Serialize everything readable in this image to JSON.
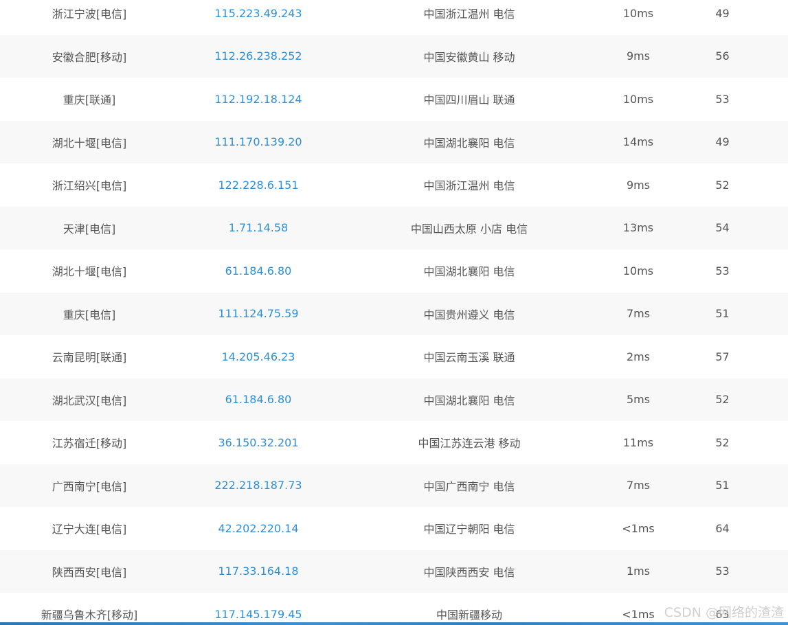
{
  "rows": [
    {
      "node": "浙江宁波[电信]",
      "ip": "115.223.49.243",
      "location": "中国浙江温州 电信",
      "rt": "10ms",
      "ttl": "49"
    },
    {
      "node": "安徽合肥[移动]",
      "ip": "112.26.238.252",
      "location": "中国安徽黄山 移动",
      "rt": "9ms",
      "ttl": "56"
    },
    {
      "node": "重庆[联通]",
      "ip": "112.192.18.124",
      "location": "中国四川眉山 联通",
      "rt": "10ms",
      "ttl": "53"
    },
    {
      "node": "湖北十堰[电信]",
      "ip": "111.170.139.20",
      "location": "中国湖北襄阳 电信",
      "rt": "14ms",
      "ttl": "49"
    },
    {
      "node": "浙江绍兴[电信]",
      "ip": "122.228.6.151",
      "location": "中国浙江温州 电信",
      "rt": "9ms",
      "ttl": "52"
    },
    {
      "node": "天津[电信]",
      "ip": "1.71.14.58",
      "location": "中国山西太原 小店 电信",
      "rt": "13ms",
      "ttl": "54"
    },
    {
      "node": "湖北十堰[电信]",
      "ip": "61.184.6.80",
      "location": "中国湖北襄阳 电信",
      "rt": "10ms",
      "ttl": "53"
    },
    {
      "node": "重庆[电信]",
      "ip": "111.124.75.59",
      "location": "中国贵州遵义 电信",
      "rt": "7ms",
      "ttl": "51"
    },
    {
      "node": "云南昆明[联通]",
      "ip": "14.205.46.23",
      "location": "中国云南玉溪 联通",
      "rt": "2ms",
      "ttl": "57"
    },
    {
      "node": "湖北武汉[电信]",
      "ip": "61.184.6.80",
      "location": "中国湖北襄阳 电信",
      "rt": "5ms",
      "ttl": "52"
    },
    {
      "node": "江苏宿迁[移动]",
      "ip": "36.150.32.201",
      "location": "中国江苏连云港 移动",
      "rt": "11ms",
      "ttl": "52"
    },
    {
      "node": "广西南宁[电信]",
      "ip": "222.218.187.73",
      "location": "中国广西南宁 电信",
      "rt": "7ms",
      "ttl": "51"
    },
    {
      "node": "辽宁大连[电信]",
      "ip": "42.202.220.14",
      "location": "中国辽宁朝阳 电信",
      "rt": "<1ms",
      "ttl": "64"
    },
    {
      "node": "陕西西安[电信]",
      "ip": "117.33.164.18",
      "location": "中国陕西西安 电信",
      "rt": "1ms",
      "ttl": "53"
    },
    {
      "node": "新疆乌鲁木齐[移动]",
      "ip": "117.145.179.45",
      "location": "中国新疆移动",
      "rt": "<1ms",
      "ttl": "63"
    }
  ],
  "watermark": "CSDN @网络的渣渣",
  "colors": {
    "text": "#555555",
    "ip_link": "#2b8fd8",
    "row_alt": "#f8f8f8",
    "bottom_bar": "#2f7fc2"
  }
}
